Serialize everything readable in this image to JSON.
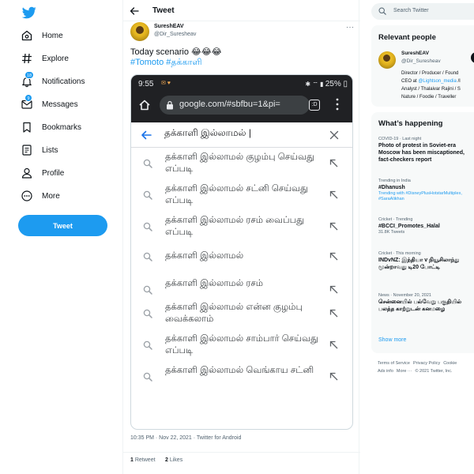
{
  "nav": {
    "items": [
      {
        "label": "Home",
        "icon": "home-icon"
      },
      {
        "label": "Explore",
        "icon": "hashtag-icon"
      },
      {
        "label": "Notifications",
        "icon": "bell-icon",
        "badge": "18"
      },
      {
        "label": "Messages",
        "icon": "mail-icon",
        "badge": "9"
      },
      {
        "label": "Bookmarks",
        "icon": "bookmark-icon"
      },
      {
        "label": "Lists",
        "icon": "list-icon"
      },
      {
        "label": "Profile",
        "icon": "profile-icon"
      },
      {
        "label": "More",
        "icon": "more-icon"
      }
    ],
    "tweet_button": "Tweet"
  },
  "header": {
    "title": "Tweet"
  },
  "tweet": {
    "author_name": "SureshEAV",
    "author_handle": "@Dir_Suresheav",
    "text": "Today scenario 😂😂😂",
    "hashtags": "#Tomoto #தக்காளி",
    "meta": "10:35 PM · Nov 22, 2021 · Twitter for Android",
    "retweets_count": "1",
    "retweets_label": "Retweet",
    "likes_count": "2",
    "likes_label": "Likes"
  },
  "phone": {
    "time": "9:55",
    "battery": "25%",
    "url": "google.com/#sbfbu=1&pi=",
    "tabs_count": ":D",
    "query": "தக்காளி இல்லாமல் |",
    "suggestions": [
      "தக்காளி இல்லாமல் குழம்பு செய்வது எப்படி",
      "தக்காளி இல்லாமல் சட்னி செய்வது எப்படி",
      "தக்காளி இல்லாமல் ரசம் வைப்பது எப்படி",
      "தக்காளி இல்லாமல்",
      "தக்காளி இல்லாமல் ரசம்",
      "தக்காளி இல்லாமல் என்ன குழம்பு வைக்கலாம்",
      "தக்காளி இல்லாமல் சாம்பார் செய்வது எப்படி",
      "தக்காளி இல்லாமல் வெங்காய சட்னி"
    ]
  },
  "right": {
    "search_placeholder": "Search Twitter",
    "relevant": {
      "title": "Relevant people",
      "name": "SureshEAV",
      "handle": "@Dir_Suresheav",
      "bio_1": "Director / Producer / Found",
      "bio_2a": "CEO at ",
      "bio_2link": "@Lightson_media",
      "bio_2b": " /I",
      "bio_3": "Analyst / Thalaivar Rajini / S",
      "bio_4": "Nature / Foodie / Traveller"
    },
    "happening": {
      "title": "What’s happening",
      "trends": [
        {
          "meta": "COVID-19 · Last night",
          "title": "Photo of protest in Soviet-era Moscow has been miscaptioned, fact-checkers report",
          "sub": ""
        },
        {
          "meta": "Trending in India",
          "title": "#Dhanush",
          "sub": "Trending with #DisneyPlusHotstarMultiplex, #SaraAlikhan"
        },
        {
          "meta": "Cricket · Trending",
          "title": "#BCCI_Promotes_Halal",
          "sub": "31.8K Tweets"
        },
        {
          "meta": "Cricket · This morning",
          "title": "INDvNZ: இந்தியா v நியூசிலாந்து மூன்றாவது டி20 போட்டி",
          "sub": ""
        },
        {
          "meta": "News · November 20, 2021",
          "title": "சென்னையில் பல்வேறு பகுதியில் பலத்த காற்றுடன் கனமழை",
          "sub": ""
        }
      ],
      "show_more": "Show more"
    },
    "footer": {
      "terms": "Terms of Service",
      "privacy": "Privacy Policy",
      "cookie": "Cookie",
      "ads": "Ads info",
      "more": "More ···",
      "copyright": "© 2021 Twitter, Inc."
    }
  }
}
